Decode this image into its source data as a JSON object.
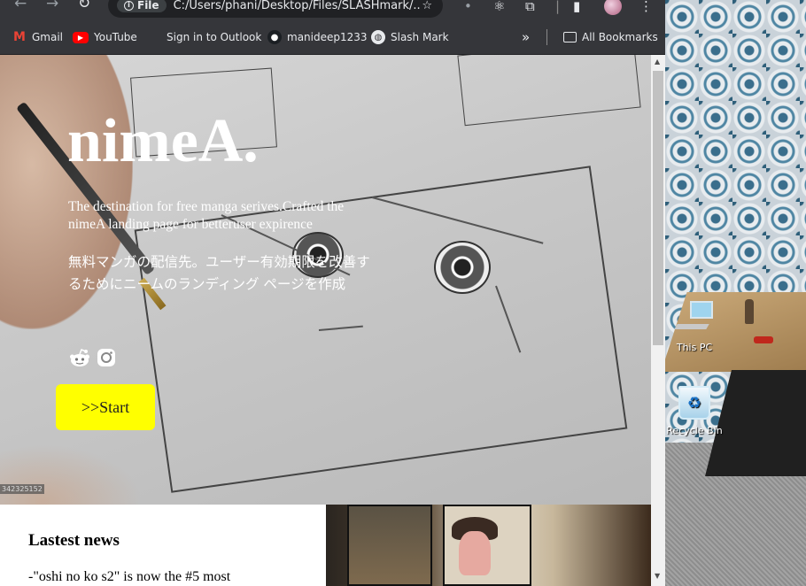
{
  "browser": {
    "url_chip": "File",
    "url": "C:/Users/phani/Desktop/Files/SLASHmark/..."
  },
  "bookmarks": {
    "items": [
      {
        "label": "Gmail",
        "icon": "gmail-icon"
      },
      {
        "label": "YouTube",
        "icon": "youtube-icon"
      },
      {
        "label": "Sign in to Outlook",
        "icon": "microsoft-icon"
      },
      {
        "label": "manideep1233",
        "icon": "github-icon"
      },
      {
        "label": "Slash Mark",
        "icon": "globe-icon"
      }
    ],
    "overflow": "»",
    "all_bookmarks": "All Bookmarks"
  },
  "hero": {
    "title": "nimeA.",
    "tagline": "The destination for free manga serives.Crafted the nimeA landing page for betteruser expirence",
    "tagline_jp": "無料マンガの配信先。ユーザー有効期限を改善するためにニームのランディング ページを作成",
    "start_label": ">>Start",
    "watermark": "342325152",
    "social_icons": [
      "reddit-icon",
      "instagram-icon"
    ],
    "accent_color": "#ffff00"
  },
  "news": {
    "title": "Lastest news",
    "first_item": "-\"oshi no ko s2\" is now the #5 most"
  },
  "desktop": {
    "icons": [
      {
        "label": "This PC"
      },
      {
        "label": "Recycle Bin"
      }
    ]
  }
}
